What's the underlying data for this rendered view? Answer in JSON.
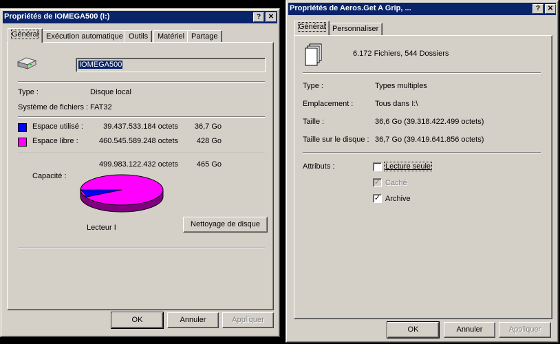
{
  "left": {
    "title": "Propriétés de IOMEGA500 (I:)",
    "help_btn": "?",
    "close_btn": "✕",
    "tabs": [
      "Général",
      "Exécution automatique",
      "Outils",
      "Matériel",
      "Partage"
    ],
    "name_value": "IOMEGA500",
    "type_label": "Type :",
    "type_value": "Disque local",
    "fs_label": "Système de fichiers :",
    "fs_value": "FAT32",
    "used_label": "Espace utilisé :",
    "used_bytes": "39.437.533.184 octets",
    "used_size": "36,7 Go",
    "free_label": "Espace libre :",
    "free_bytes": "460.545.589.248 octets",
    "free_size": "428 Go",
    "capacity_label": "Capacité :",
    "capacity_bytes": "499.983.122.432 octets",
    "capacity_size": "465 Go",
    "drive_label": "Lecteur I",
    "cleanup_btn": "Nettoyage de disque",
    "ok_btn": "OK",
    "cancel_btn": "Annuler",
    "apply_btn": "Appliquer",
    "used_color": "#0000ff",
    "free_color": "#ff00ff",
    "used_fraction": 0.079
  },
  "right": {
    "title": "Propriétés de Aeros.Get A Grip, ...",
    "help_btn": "?",
    "close_btn": "✕",
    "tabs": [
      "Général",
      "Personnaliser"
    ],
    "summary": "6.172 Fichiers, 544 Dossiers",
    "type_label": "Type :",
    "type_value": "Types multiples",
    "location_label": "Emplacement :",
    "location_value": "Tous dans I:\\",
    "size_label": "Taille :",
    "size_value": "36,6 Go (39.318.422.499 octets)",
    "disk_size_label": "Taille sur le disque :",
    "disk_size_value": "36,7 Go (39.419.641.856 octets)",
    "attributes_label": "Attributs :",
    "attr_readonly": "Lecture seule",
    "attr_hidden": "Caché",
    "attr_archive": "Archive",
    "ok_btn": "OK",
    "cancel_btn": "Annuler",
    "apply_btn": "Appliquer"
  }
}
